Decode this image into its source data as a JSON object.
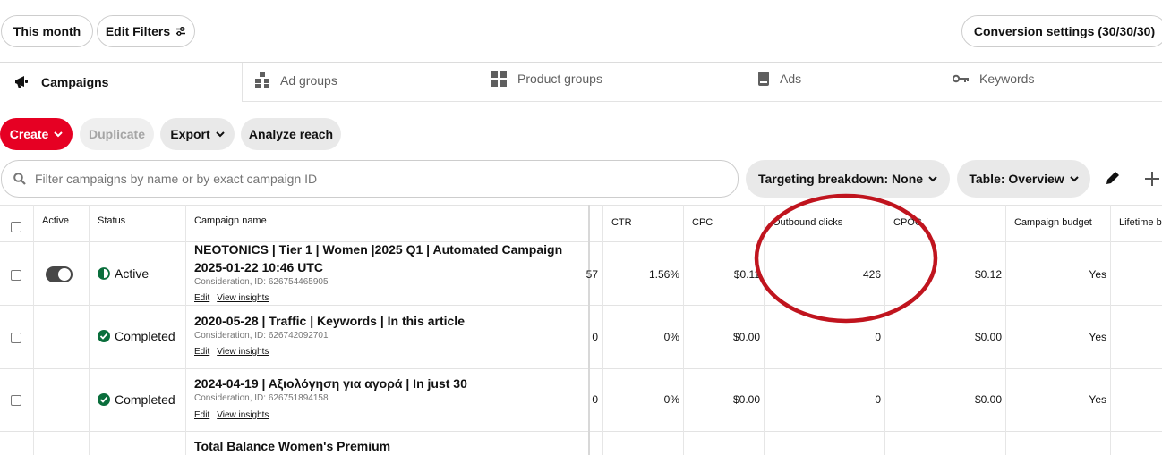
{
  "toolbar": {
    "date_range": "This month",
    "edit_filters": "Edit Filters",
    "conversion_settings": "Conversion settings (30/30/30)"
  },
  "tabs": [
    {
      "label": "Campaigns",
      "icon": "megaphone-icon",
      "active": true
    },
    {
      "label": "Ad groups",
      "icon": "ad-groups-icon"
    },
    {
      "label": "Product groups",
      "icon": "grid-icon"
    },
    {
      "label": "Ads",
      "icon": "phone-icon"
    },
    {
      "label": "Keywords",
      "icon": "key-icon"
    }
  ],
  "actions": {
    "create": "Create",
    "duplicate": "Duplicate",
    "export": "Export",
    "analyze_reach": "Analyze reach"
  },
  "search": {
    "placeholder": "Filter campaigns by name or by exact campaign ID"
  },
  "view": {
    "targeting": "Targeting breakdown: None",
    "table": "Table: Overview"
  },
  "columns": {
    "active": "Active",
    "status": "Status",
    "campaign_name": "Campaign name",
    "ctr": "CTR",
    "cpc": "CPC",
    "outbound_clicks": "Outbound clicks",
    "cpoc": "CPOC",
    "campaign_budget": "Campaign budget",
    "lifetime": "Lifetime b"
  },
  "links": {
    "edit": "Edit",
    "view_insights": "View insights"
  },
  "rows": [
    {
      "name_line1": "NEOTONICS | Tier 1 | Women |2025 Q1 | Automated Campaign",
      "name_line2": "2025-01-22 10:46 UTC",
      "meta": "Consideration, ID: 626754465905",
      "status": "Active",
      "status_icon": "half-circle-icon",
      "toggle_on": true,
      "prev": "57",
      "ctr": "1.56%",
      "cpc": "$0.11",
      "outbound_clicks": "426",
      "cpoc": "$0.12",
      "campaign_budget": "Yes"
    },
    {
      "name_line1": "2020-05-28 | Traffic | Keywords | In this article",
      "meta": "Consideration, ID: 626742092701",
      "status": "Completed",
      "status_icon": "check-circle-icon",
      "prev": "0",
      "ctr": "0%",
      "cpc": "$0.00",
      "outbound_clicks": "0",
      "cpoc": "$0.00",
      "campaign_budget": "Yes"
    },
    {
      "name_line1": "2024-04-19 | Αξιολόγηση για αγορά | In just 30",
      "meta": "Consideration, ID: 626751894158",
      "status": "Completed",
      "status_icon": "check-circle-icon",
      "prev": "0",
      "ctr": "0%",
      "cpc": "$0.00",
      "outbound_clicks": "0",
      "cpoc": "$0.00",
      "campaign_budget": "Yes"
    },
    {
      "name_line1": "Total Balance Women's Premium"
    }
  ],
  "colors": {
    "accent": "#e60023",
    "annotation": "#c0141e",
    "completed": "#0a6e3c"
  }
}
